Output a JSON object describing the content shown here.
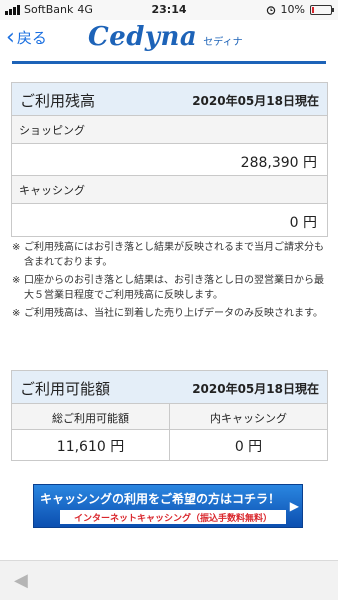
{
  "status": {
    "carrier": "SoftBank",
    "network": "4G",
    "time": "23:14",
    "alarm_icon": "alarm-icon",
    "battery_label": "10%",
    "battery_level": 0.1,
    "battery_color": "#d9262c"
  },
  "nav": {
    "back_label": "戻る",
    "logo_text": "Cedyna",
    "logo_kana": "セディナ",
    "brand_color": "#1d63b8"
  },
  "balance": {
    "title": "ご利用残高",
    "date": "2020年05月18日現在",
    "shopping_label": "ショッピング",
    "shopping_value": "288,390 円",
    "cashing_label": "キャッシング",
    "cashing_value": "0 円"
  },
  "notes": [
    "ご利用残高にはお引き落とし結果が反映されるまで当月ご請求分も含まれております。",
    "口座からのお引き落とし結果は、お引き落とし日の翌営業日から最大５営業日程度でご利用残高に反映します。",
    "ご利用残高は、当社に到着した売り上げデータのみ反映されます。"
  ],
  "note_mark": "※",
  "available": {
    "title": "ご利用可能額",
    "date": "2020年05月18日現在",
    "total_label": "総ご利用可能額",
    "cashing_label": "内キャッシング",
    "total_value": "11,610 円",
    "cashing_value": "0 円"
  },
  "banner": {
    "main": "キャッシングの利用をご希望の方はコチラ！",
    "sub": "インターネットキャッシング（振込手数料無料）",
    "arrow": "▶"
  },
  "toolbar": {
    "back_icon": "◀"
  }
}
